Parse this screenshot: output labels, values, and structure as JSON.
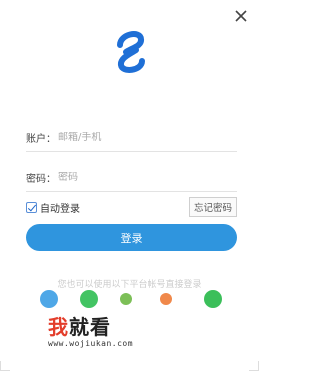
{
  "window": {
    "close_icon": "close-icon",
    "logo_icon": "app-logo-icon"
  },
  "form": {
    "account_label": "账户：",
    "account_placeholder": "邮箱/手机",
    "password_label": "密码：",
    "password_placeholder": "密码",
    "auto_login_label": "自动登录",
    "auto_login_checked": true,
    "forgot_password": "忘记密码",
    "login_button": "登录"
  },
  "third_party": {
    "hint": "您也可以使用以下平台帐号直接登录"
  },
  "watermark": {
    "title_part1": "我",
    "title_part2": "就看",
    "url": "www.wojiukan.com"
  },
  "colors": {
    "primary": "#2f95de",
    "logo": "#1f6fd6",
    "watermark_red": "#e33d2b"
  }
}
